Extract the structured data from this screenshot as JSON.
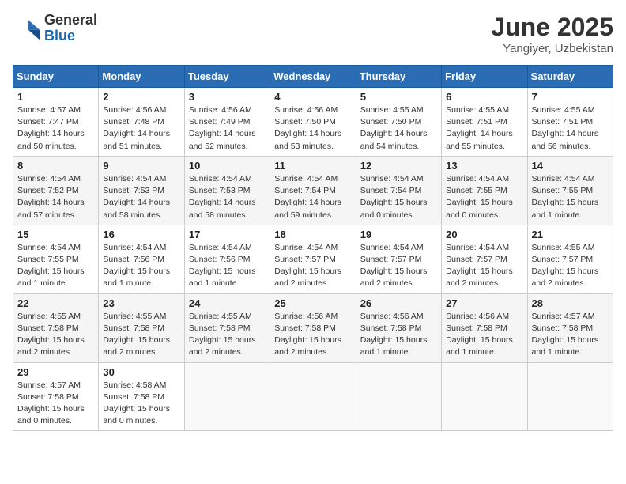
{
  "header": {
    "logo_general": "General",
    "logo_blue": "Blue",
    "month_title": "June 2025",
    "location": "Yangiyer, Uzbekistan"
  },
  "days_of_week": [
    "Sunday",
    "Monday",
    "Tuesday",
    "Wednesday",
    "Thursday",
    "Friday",
    "Saturday"
  ],
  "weeks": [
    [
      {
        "day": 1,
        "sunrise": "4:57 AM",
        "sunset": "7:47 PM",
        "daylight": "14 hours and 50 minutes."
      },
      {
        "day": 2,
        "sunrise": "4:56 AM",
        "sunset": "7:48 PM",
        "daylight": "14 hours and 51 minutes."
      },
      {
        "day": 3,
        "sunrise": "4:56 AM",
        "sunset": "7:49 PM",
        "daylight": "14 hours and 52 minutes."
      },
      {
        "day": 4,
        "sunrise": "4:56 AM",
        "sunset": "7:50 PM",
        "daylight": "14 hours and 53 minutes."
      },
      {
        "day": 5,
        "sunrise": "4:55 AM",
        "sunset": "7:50 PM",
        "daylight": "14 hours and 54 minutes."
      },
      {
        "day": 6,
        "sunrise": "4:55 AM",
        "sunset": "7:51 PM",
        "daylight": "14 hours and 55 minutes."
      },
      {
        "day": 7,
        "sunrise": "4:55 AM",
        "sunset": "7:51 PM",
        "daylight": "14 hours and 56 minutes."
      }
    ],
    [
      {
        "day": 8,
        "sunrise": "4:54 AM",
        "sunset": "7:52 PM",
        "daylight": "14 hours and 57 minutes."
      },
      {
        "day": 9,
        "sunrise": "4:54 AM",
        "sunset": "7:53 PM",
        "daylight": "14 hours and 58 minutes."
      },
      {
        "day": 10,
        "sunrise": "4:54 AM",
        "sunset": "7:53 PM",
        "daylight": "14 hours and 58 minutes."
      },
      {
        "day": 11,
        "sunrise": "4:54 AM",
        "sunset": "7:54 PM",
        "daylight": "14 hours and 59 minutes."
      },
      {
        "day": 12,
        "sunrise": "4:54 AM",
        "sunset": "7:54 PM",
        "daylight": "15 hours and 0 minutes."
      },
      {
        "day": 13,
        "sunrise": "4:54 AM",
        "sunset": "7:55 PM",
        "daylight": "15 hours and 0 minutes."
      },
      {
        "day": 14,
        "sunrise": "4:54 AM",
        "sunset": "7:55 PM",
        "daylight": "15 hours and 1 minute."
      }
    ],
    [
      {
        "day": 15,
        "sunrise": "4:54 AM",
        "sunset": "7:55 PM",
        "daylight": "15 hours and 1 minute."
      },
      {
        "day": 16,
        "sunrise": "4:54 AM",
        "sunset": "7:56 PM",
        "daylight": "15 hours and 1 minute."
      },
      {
        "day": 17,
        "sunrise": "4:54 AM",
        "sunset": "7:56 PM",
        "daylight": "15 hours and 1 minute."
      },
      {
        "day": 18,
        "sunrise": "4:54 AM",
        "sunset": "7:57 PM",
        "daylight": "15 hours and 2 minutes."
      },
      {
        "day": 19,
        "sunrise": "4:54 AM",
        "sunset": "7:57 PM",
        "daylight": "15 hours and 2 minutes."
      },
      {
        "day": 20,
        "sunrise": "4:54 AM",
        "sunset": "7:57 PM",
        "daylight": "15 hours and 2 minutes."
      },
      {
        "day": 21,
        "sunrise": "4:55 AM",
        "sunset": "7:57 PM",
        "daylight": "15 hours and 2 minutes."
      }
    ],
    [
      {
        "day": 22,
        "sunrise": "4:55 AM",
        "sunset": "7:58 PM",
        "daylight": "15 hours and 2 minutes."
      },
      {
        "day": 23,
        "sunrise": "4:55 AM",
        "sunset": "7:58 PM",
        "daylight": "15 hours and 2 minutes."
      },
      {
        "day": 24,
        "sunrise": "4:55 AM",
        "sunset": "7:58 PM",
        "daylight": "15 hours and 2 minutes."
      },
      {
        "day": 25,
        "sunrise": "4:56 AM",
        "sunset": "7:58 PM",
        "daylight": "15 hours and 2 minutes."
      },
      {
        "day": 26,
        "sunrise": "4:56 AM",
        "sunset": "7:58 PM",
        "daylight": "15 hours and 1 minute."
      },
      {
        "day": 27,
        "sunrise": "4:56 AM",
        "sunset": "7:58 PM",
        "daylight": "15 hours and 1 minute."
      },
      {
        "day": 28,
        "sunrise": "4:57 AM",
        "sunset": "7:58 PM",
        "daylight": "15 hours and 1 minute."
      }
    ],
    [
      {
        "day": 29,
        "sunrise": "4:57 AM",
        "sunset": "7:58 PM",
        "daylight": "15 hours and 0 minutes."
      },
      {
        "day": 30,
        "sunrise": "4:58 AM",
        "sunset": "7:58 PM",
        "daylight": "15 hours and 0 minutes."
      },
      null,
      null,
      null,
      null,
      null
    ]
  ]
}
